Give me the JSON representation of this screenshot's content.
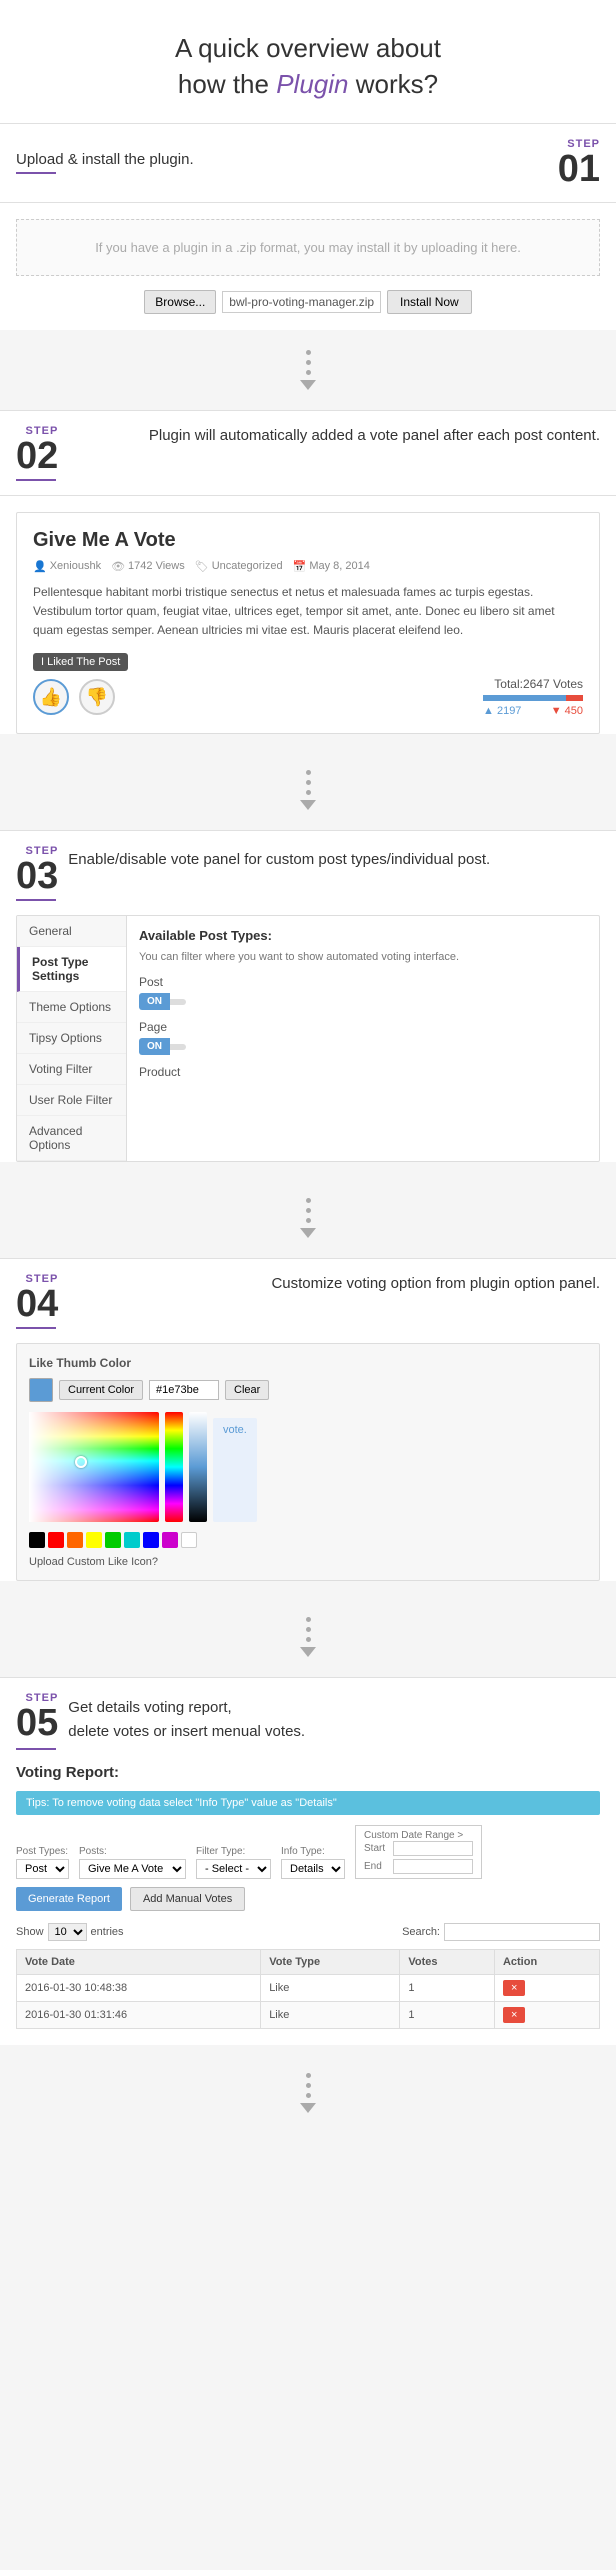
{
  "header": {
    "title_line1": "A quick overview about",
    "title_line2": "how the",
    "title_plugin": "Plugin",
    "title_line3": "works?"
  },
  "steps": [
    {
      "id": "01",
      "label": "STEP",
      "number": "01",
      "title": "Upload & install the plugin.",
      "upload_hint": "If you have a plugin in a .zip format, you may install it by uploading it here.",
      "browse_label": "Browse...",
      "filename": "bwl-pro-voting-manager.zip",
      "install_btn": "Install Now"
    },
    {
      "id": "02",
      "label": "STEP",
      "number": "02",
      "desc": "Plugin will automatically added a vote panel after each post content.",
      "post_title": "Give Me A Vote",
      "meta": [
        {
          "icon": "👤",
          "text": "Xenioushk"
        },
        {
          "icon": "👁",
          "text": "1742 Views"
        },
        {
          "icon": "🏷",
          "text": "Uncategorized"
        },
        {
          "icon": "📅",
          "text": "May 8, 2014"
        }
      ],
      "post_excerpt": "Pellentesque habitant morbi tristique senectus et netus et malesuada fames ac turpis egestas. Vestibulum tortor quam, feugiat vitae, ultrices eget, tempor sit amet, ante. Donec eu libero sit amet quam egestas semper. Aenean ultricies mi vitae est. Mauris placerat eleifend leo.",
      "tooltip": "I Liked The Post",
      "total_votes": "Total:2647 Votes",
      "up_count": "2197",
      "down_count": "450"
    },
    {
      "id": "03",
      "label": "STEP",
      "number": "03",
      "desc": "Enable/disable vote panel for custom post types/individual post.",
      "available_post_types": "Available Post Types:",
      "filter_note": "You can filter where you want to show automated voting interface.",
      "sidebar_items": [
        "General",
        "Post Type Settings",
        "Theme Options",
        "Tipsy Options",
        "Voting Filter",
        "User Role Filter",
        "Advanced Options"
      ],
      "post_toggle": "Post",
      "page_toggle": "Page",
      "product_label": "Product",
      "on_label": "ON",
      "off_label": ""
    },
    {
      "id": "04",
      "label": "STEP",
      "number": "04",
      "desc": "Customize voting option from plugin option panel.",
      "color_label": "Like Thumb Color",
      "current_color_btn": "Current Color",
      "hex_value": "#1e73be",
      "clear_btn": "Clear",
      "vote_text": "vote.",
      "upload_icon_label": "Upload Custom Like Icon?",
      "swatches": [
        "#000000",
        "#ff0000",
        "#ff6600",
        "#ffff00",
        "#00cc00",
        "#00cccc",
        "#0000ff",
        "#cc00cc",
        "#ffffff"
      ]
    },
    {
      "id": "05",
      "label": "STEP",
      "number": "05",
      "desc_line1": "Get details voting report,",
      "desc_line2": "delete votes or insert menual votes.",
      "voting_report_title": "Voting Report:",
      "tip": "Tips: To remove voting data select \"Info Type\" value as \"Details\"",
      "filter_labels": {
        "post_types": "Post Types:",
        "posts": "Posts:",
        "filter_type": "Filter Type:",
        "info_type": "Info Type:",
        "date_range": "Custom Date Range >"
      },
      "filter_values": {
        "post_type": "Post",
        "post": "Give Me A Vote",
        "filter": "- Select -",
        "info": "Details"
      },
      "generate_btn": "Generate Report",
      "manual_votes_btn": "Add Manual Votes",
      "show_label": "Show",
      "entries_label": "entries",
      "show_count": "10",
      "search_label": "Search:",
      "table_headers": [
        "Vote Date",
        "Vote Type",
        "Votes",
        "Action"
      ],
      "table_rows": [
        {
          "date": "2016-01-30 10:48:38",
          "type": "Like",
          "votes": "1",
          "action": "×"
        },
        {
          "date": "2016-01-30 01:31:46",
          "type": "Like",
          "votes": "1",
          "action": "×"
        }
      ],
      "date_start_label": "Start",
      "date_end_label": "End"
    }
  ]
}
